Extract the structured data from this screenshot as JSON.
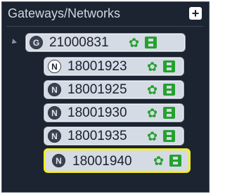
{
  "panel": {
    "title": "Gateways/Networks",
    "add_button_label": "+"
  },
  "tree": {
    "gateway": {
      "badge": "G",
      "label": "21000831",
      "expanded": true
    },
    "networks": [
      {
        "badge": "N",
        "label": "18001923",
        "badge_style": "white",
        "selected": false
      },
      {
        "badge": "N",
        "label": "18001925",
        "badge_style": "dark",
        "selected": false
      },
      {
        "badge": "N",
        "label": "18001930",
        "badge_style": "dark",
        "selected": false
      },
      {
        "badge": "N",
        "label": "18001935",
        "badge_style": "dark",
        "selected": false
      },
      {
        "badge": "N",
        "label": "18001940",
        "badge_style": "dark",
        "selected": true
      }
    ]
  },
  "icons": {
    "settings": "gear-icon",
    "save": "save-icon",
    "expand": "expand-arrow-icon",
    "add": "plus-icon"
  },
  "colors": {
    "panel_background": "#1c2331",
    "node_background": "#d5dbe4",
    "icon_green": "#25a12f",
    "selection_yellow": "#f2ef21"
  }
}
